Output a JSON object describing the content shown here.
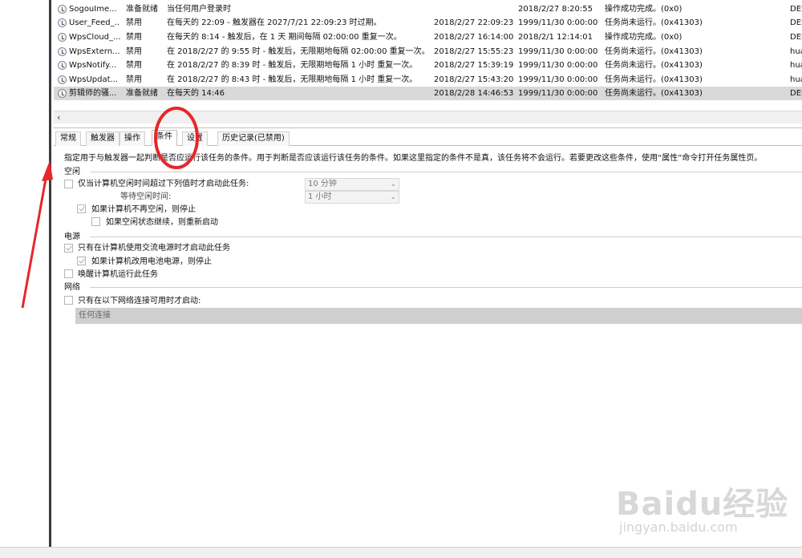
{
  "tasks": [
    {
      "name": "SogouIme...",
      "status": "准备就绪",
      "trigger": "当任何用户登录时",
      "next_run": "",
      "last_run": "2018/2/27 8:20:55",
      "result": "操作成功完成。(0x0)",
      "author": "DES"
    },
    {
      "name": "User_Feed_...",
      "status": "禁用",
      "trigger": "在每天的 22:09 - 触发器在 2027/7/21 22:09:23 时过期。",
      "next_run": "2018/2/27 22:09:23",
      "last_run": "1999/11/30 0:00:00",
      "result": "任务尚未运行。(0x41303)",
      "author": "DES"
    },
    {
      "name": "WpsCloud_...",
      "status": "禁用",
      "trigger": "在每天的 8:14 - 触发后，在 1 天 期间每隔 02:00:00 重复一次。",
      "next_run": "2018/2/27 16:14:00",
      "last_run": "2018/2/1 12:14:01",
      "result": "操作成功完成。(0x0)",
      "author": "DES"
    },
    {
      "name": "WpsExtern...",
      "status": "禁用",
      "trigger": "在 2018/2/27 的 9:55 时 - 触发后，无限期地每隔 02:00:00 重复一次。",
      "next_run": "2018/2/27 15:55:23",
      "last_run": "1999/11/30 0:00:00",
      "result": "任务尚未运行。(0x41303)",
      "author": "hua"
    },
    {
      "name": "WpsNotify...",
      "status": "禁用",
      "trigger": "在 2018/2/27 的 8:39 时 - 触发后，无限期地每隔 1 小时 重复一次。",
      "next_run": "2018/2/27 15:39:19",
      "last_run": "1999/11/30 0:00:00",
      "result": "任务尚未运行。(0x41303)",
      "author": "hua"
    },
    {
      "name": "WpsUpdat...",
      "status": "禁用",
      "trigger": "在 2018/2/27 的 8:43 时 - 触发后，无限期地每隔 1 小时 重复一次。",
      "next_run": "2018/2/27 15:43:20",
      "last_run": "1999/11/30 0:00:00",
      "result": "任务尚未运行。(0x41303)",
      "author": "hua"
    },
    {
      "name": "剪辑师的骚...",
      "status": "准备就绪",
      "trigger": "在每天的 14:46",
      "next_run": "2018/2/28 14:46:53",
      "last_run": "1999/11/30 0:00:00",
      "result": "任务尚未运行。(0x41303)",
      "author": "DES"
    }
  ],
  "tabs": [
    "常规",
    "触发器",
    "操作",
    "条件",
    "设置",
    "历史记录(已禁用)"
  ],
  "conditions": {
    "description": "指定用于与触发器一起判断是否应运行该任务的条件。用于判断是否应该运行该任务的条件。如果这里指定的条件不是真，该任务将不会运行。若要更改这些条件，使用“属性”命令打开任务属性页。",
    "idle": {
      "title": "空闲",
      "start_if_idle_label": "仅当计算机空闲时间超过下列值时才启动此任务:",
      "idle_for_value": "10 分钟",
      "wait_label": "等待空闲时间:",
      "wait_value": "1 小时",
      "stop_if_not_idle_label": "如果计算机不再空闲，则停止",
      "restart_if_idle_label": "如果空闲状态继续，则重新启动"
    },
    "power": {
      "title": "电源",
      "ac_only_label": "只有在计算机使用交流电源时才启动此任务",
      "stop_on_battery_label": "如果计算机改用电池电源，则停止",
      "wake_label": "唤醒计算机运行此任务"
    },
    "network": {
      "title": "网络",
      "network_only_label": "只有在以下网络连接可用时才启动:",
      "connection_value": "任何连接"
    }
  },
  "scroll_left_glyph": "‹",
  "watermark": {
    "brand": "Baidu经验",
    "url": "jingyan.baidu.com"
  },
  "annotation_color": "#e8262a"
}
